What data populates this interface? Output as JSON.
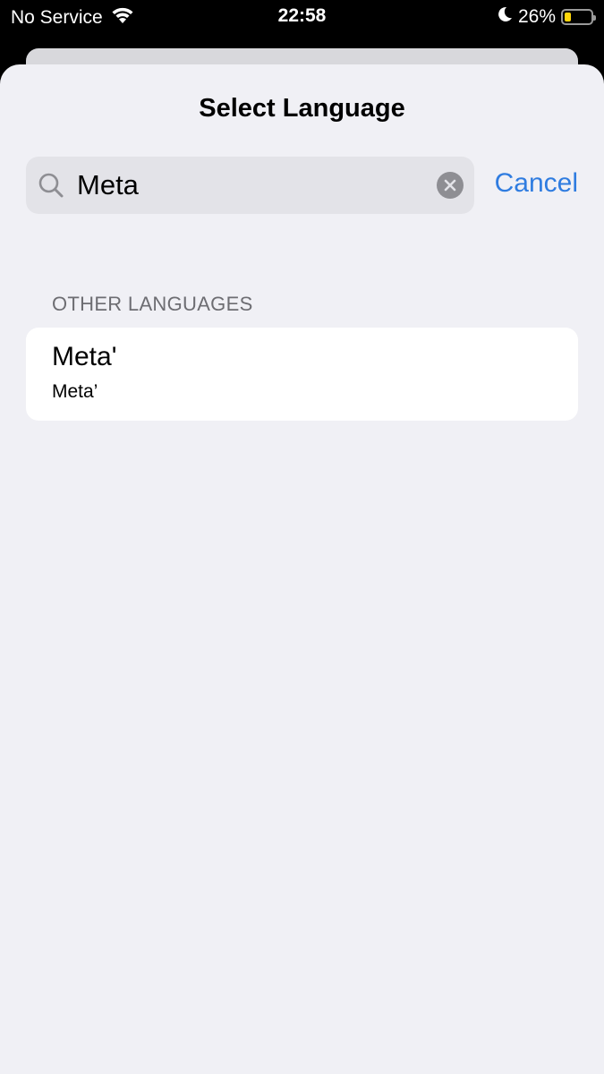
{
  "status_bar": {
    "carrier": "No Service",
    "time": "22:58",
    "battery_percent": "26%",
    "battery_level": 0.26,
    "battery_color": "#ffd60a",
    "icons": [
      "wifi-icon",
      "moon-icon",
      "battery-icon"
    ]
  },
  "sheet": {
    "title": "Select Language"
  },
  "search": {
    "value": "Meta",
    "cancel_label": "Cancel",
    "icons": [
      "search-icon",
      "clear-icon"
    ]
  },
  "sections": [
    {
      "header": "OTHER LANGUAGES",
      "items": [
        {
          "title": "Meta'",
          "subtitle": "Meta’"
        }
      ]
    }
  ],
  "colors": {
    "accent": "#2f7ce0",
    "background": "#f0f0f5",
    "search_field": "#e3e3e8",
    "section_header": "#6d6d72"
  }
}
